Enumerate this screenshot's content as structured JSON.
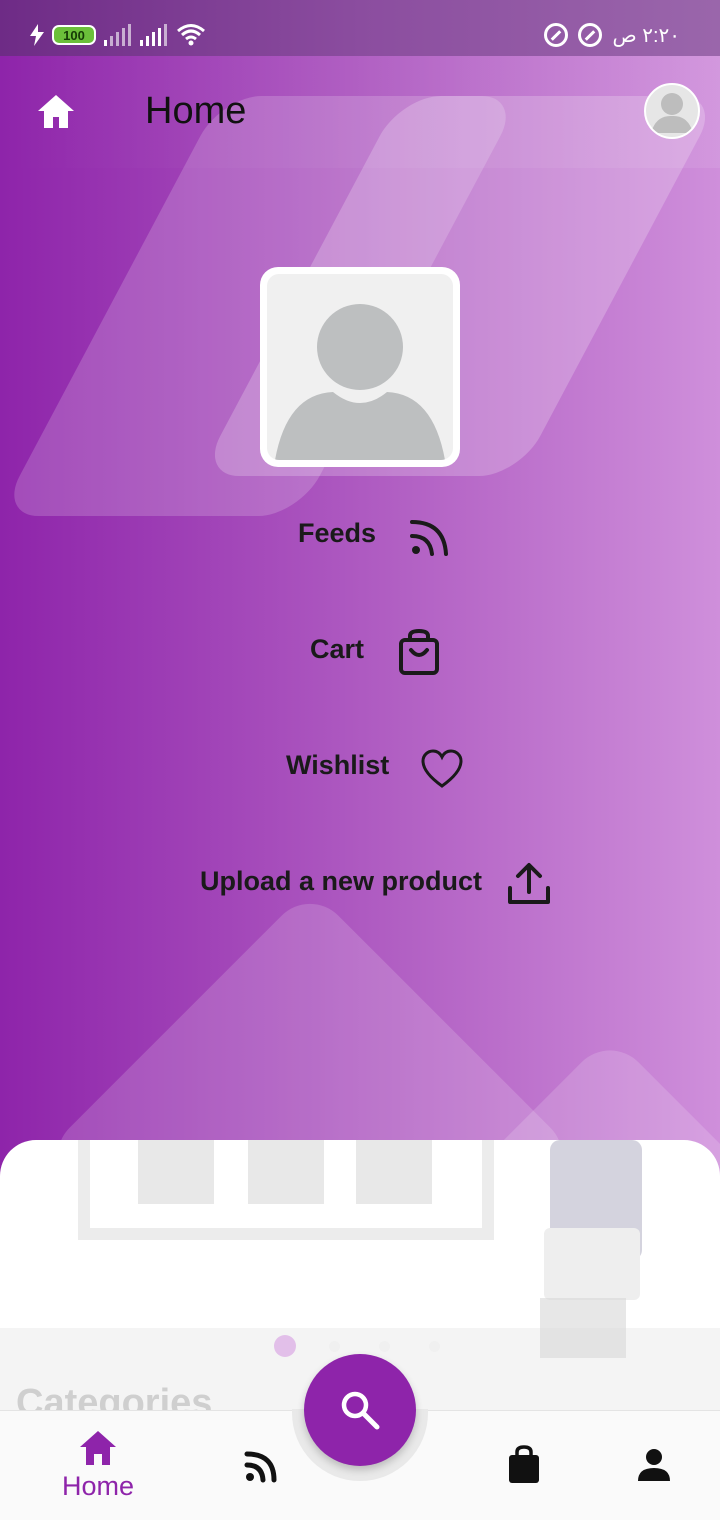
{
  "status_bar": {
    "battery": "100",
    "time": "٢:٢٠ ص"
  },
  "app_bar": {
    "title": "Home"
  },
  "menu": {
    "items": [
      {
        "label": "Feeds",
        "icon": "rss-icon"
      },
      {
        "label": "Cart",
        "icon": "shopping-bag-icon"
      },
      {
        "label": "Wishlist",
        "icon": "heart-icon"
      },
      {
        "label": "Upload a new product",
        "icon": "upload-icon"
      }
    ]
  },
  "carousel": {
    "pages": 4,
    "active_index": 0
  },
  "section": {
    "categories_title": "Categories"
  },
  "bottom_nav": {
    "items": [
      {
        "label": "Home",
        "icon": "home-icon",
        "active": true
      },
      {
        "label": "",
        "icon": "rss-icon",
        "active": false
      },
      {
        "label": "",
        "icon": "shopping-bag-icon",
        "active": false
      },
      {
        "label": "",
        "icon": "person-icon",
        "active": false
      }
    ],
    "fab_icon": "search-icon"
  },
  "colors": {
    "primary": "#8e24aa",
    "accent_light": "#cf8fdb",
    "text_dark": "#1a1a1a"
  }
}
